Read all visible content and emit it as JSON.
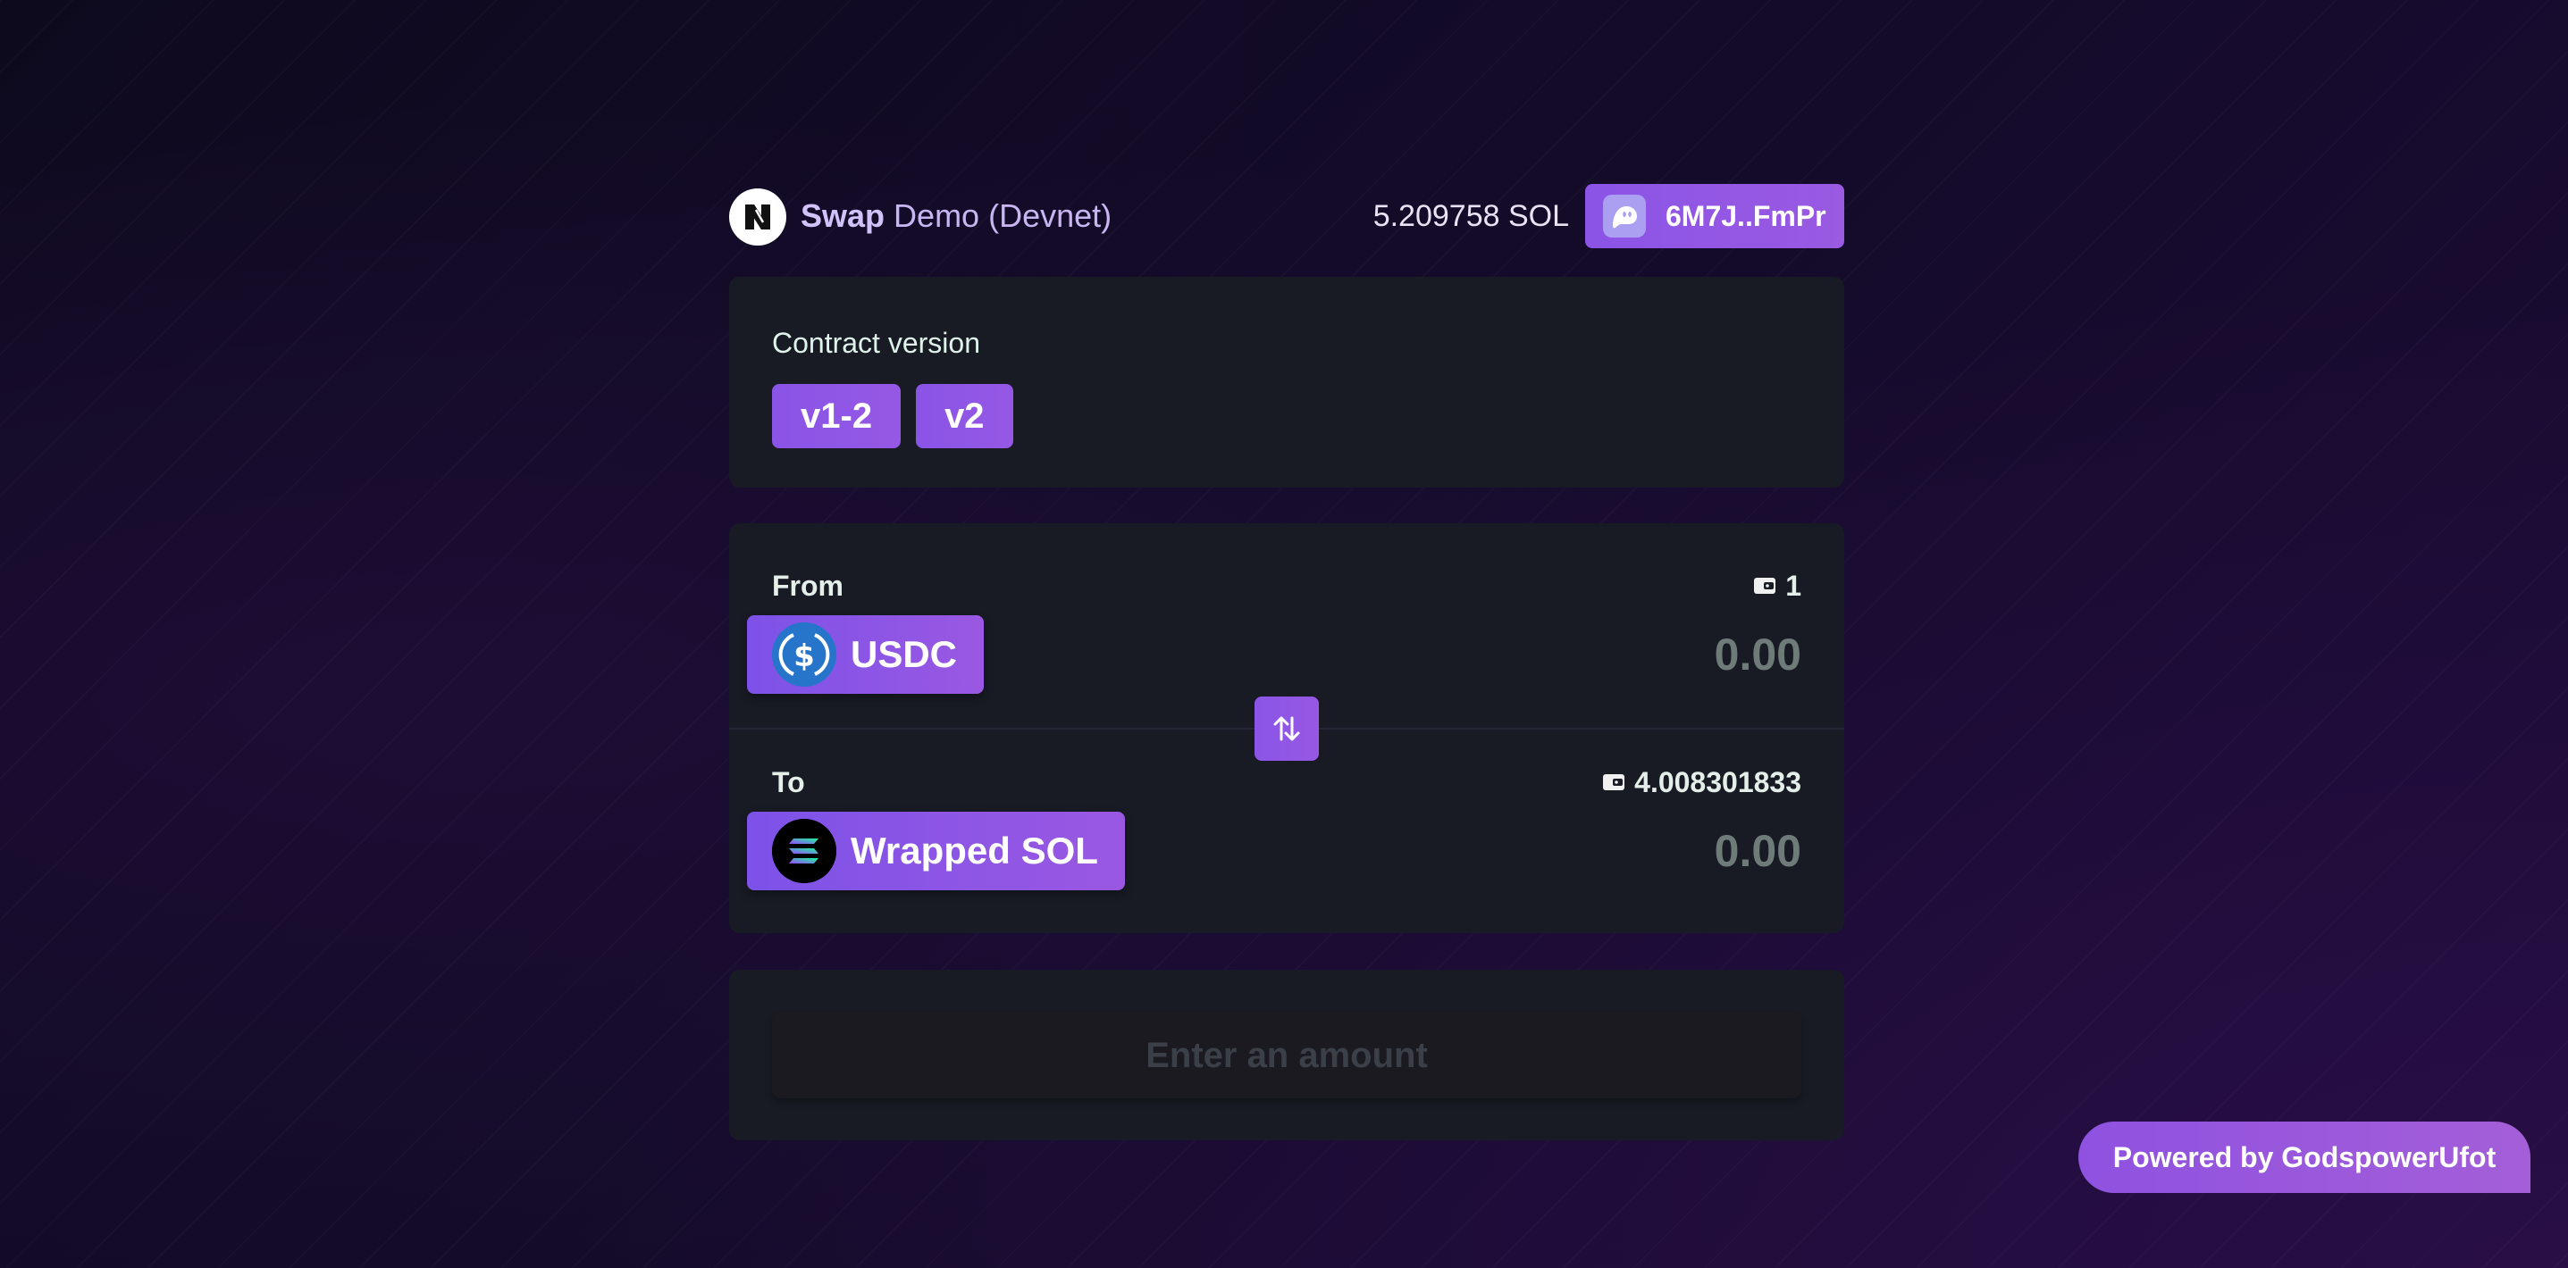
{
  "header": {
    "title_bold": "Swap",
    "title_rest": "Demo (Devnet)",
    "balance": "5.209758 SOL",
    "wallet_address": "6M7J..FmPr"
  },
  "version_card": {
    "label": "Contract version",
    "options": [
      "v1-2",
      "v2"
    ]
  },
  "swap": {
    "from": {
      "label": "From",
      "balance": "1",
      "token": "USDC",
      "placeholder": "0.00"
    },
    "to": {
      "label": "To",
      "balance": "4.008301833",
      "token": "Wrapped SOL",
      "placeholder": "0.00"
    }
  },
  "action": {
    "label": "Enter an amount"
  },
  "footer": {
    "powered_by": "Powered by GodspowerUfot"
  },
  "icons": {
    "logo": "app-logo-icon",
    "wallet": "phantom-ghost-icon",
    "balance": "wallet-icon",
    "swap": "swap-arrows-icon",
    "usdc": "usdc-logo-icon",
    "sol": "solana-logo-icon"
  },
  "colors": {
    "accent": "#8b54e6",
    "card": "#181b24",
    "background": "#120b24"
  }
}
